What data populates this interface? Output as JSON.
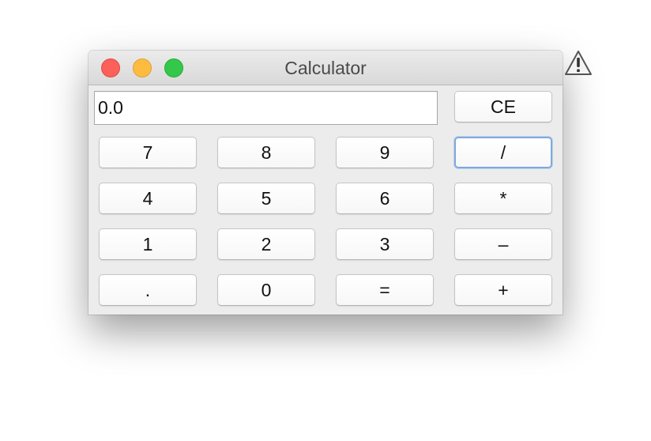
{
  "window": {
    "title": "Calculator"
  },
  "display": {
    "value": "0.0"
  },
  "buttons": {
    "clear": "CE",
    "seven": "7",
    "eight": "8",
    "nine": "9",
    "divide": "/",
    "four": "4",
    "five": "5",
    "six": "6",
    "multiply": "*",
    "one": "1",
    "two": "2",
    "three": "3",
    "subtract": "–",
    "decimal": ".",
    "zero": "0",
    "equals": "=",
    "add": "+"
  },
  "focused_button": "divide",
  "icons": {
    "warning": "warning-icon"
  },
  "colors": {
    "close": "#fc605b",
    "minimize": "#fdbc40",
    "zoom": "#34c84a",
    "focus_ring": "#7fa9e0"
  }
}
